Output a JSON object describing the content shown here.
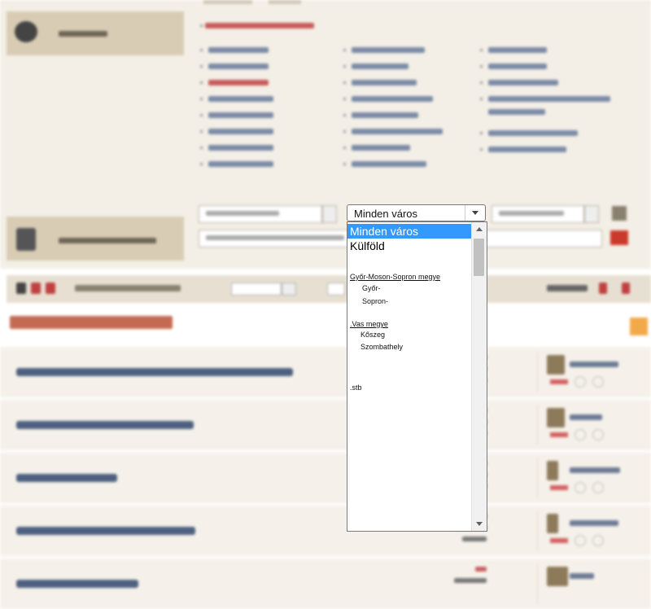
{
  "city_select": {
    "selected_value": "Minden város",
    "options": [
      {
        "label": "Minden város",
        "kind": "big",
        "selected": true
      },
      {
        "label": "Külföld",
        "kind": "big",
        "selected": false
      },
      {
        "label": "Győr-Moson-Sopron megye",
        "kind": "county",
        "selected": false
      },
      {
        "label": "Győr-",
        "kind": "city",
        "selected": false
      },
      {
        "label": "Sopron-",
        "kind": "city",
        "selected": false
      },
      {
        "label": ".Vas megye",
        "kind": "county",
        "selected": false
      },
      {
        "label": "Kőszeg",
        "kind": "city",
        "selected": false
      },
      {
        "label": "Szombathely",
        "kind": "city",
        "selected": false
      },
      {
        "label": ".stb",
        "kind": "plain",
        "selected": false
      }
    ]
  },
  "colors": {
    "panel_bg": "#f3efe6",
    "left_button_bg": "#d8ccb4",
    "selection_blue": "#3399ff",
    "accent_red": "#c93a2a",
    "section_heading": "#c46a52"
  }
}
